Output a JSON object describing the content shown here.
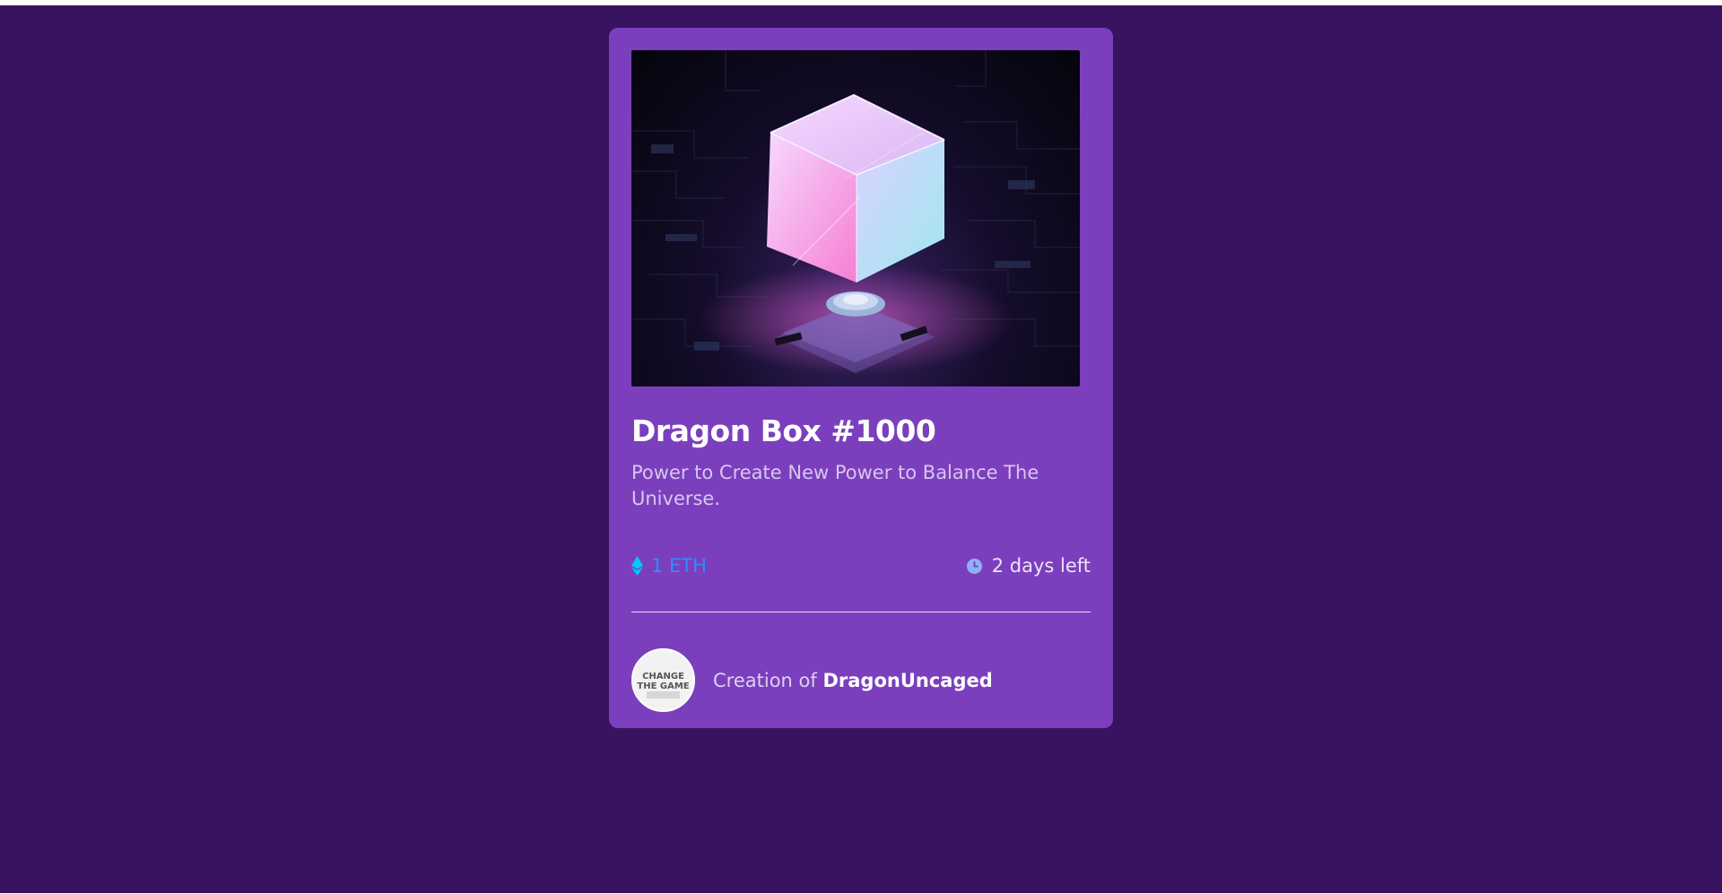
{
  "card": {
    "title": "Dragon Box #1000",
    "description": "Power to Create New Power to Balance The Universe.",
    "price": "1 ETH",
    "time_left": "2 days left",
    "creator_prefix": "Creation of ",
    "creator_name": "DragonUncaged",
    "avatar_text": [
      "CHANGE",
      "THE GAME"
    ]
  },
  "icons": {
    "price": "ethereum-icon",
    "time": "clock-icon"
  },
  "colors": {
    "page_background": "#381460",
    "card_background": "#7b3fbd",
    "price": "#2f8cff",
    "ethereum_icon": "#00c8ff"
  }
}
